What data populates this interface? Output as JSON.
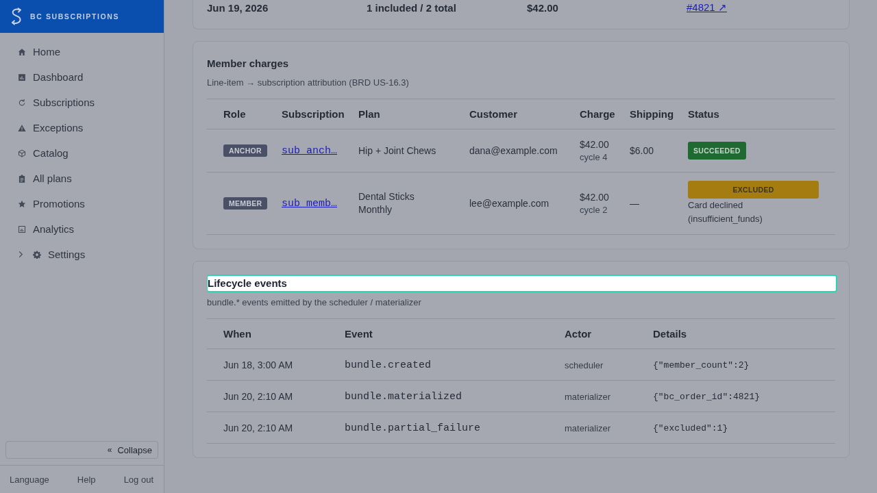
{
  "sidebar": {
    "brand": "BC SUBSCRIPTIONS",
    "items": [
      {
        "label": "Home",
        "kind": "link",
        "selected": false
      },
      {
        "label": "Dashboard",
        "kind": "link",
        "selected": false
      },
      {
        "label": "Subscriptions",
        "kind": "link",
        "selected": false
      },
      {
        "label": "Exceptions",
        "kind": "link",
        "selected": false
      },
      {
        "label": "Catalog",
        "kind": "link",
        "selected": false
      },
      {
        "label": "All plans",
        "kind": "link",
        "selected": false
      },
      {
        "label": "Promotions",
        "kind": "link",
        "selected": false
      },
      {
        "label": "Analytics",
        "kind": "link",
        "selected": false
      },
      {
        "label": "Settings",
        "kind": "group",
        "selected": false,
        "expanded": false
      }
    ],
    "collapse": {
      "glyph": "«",
      "label": "Collapse"
    },
    "footer_links": [
      "Language",
      "Help",
      "Log out"
    ]
  },
  "summary_card": {
    "row": [
      {
        "kind": "text",
        "text": "Jun 19, 2026"
      },
      {
        "kind": "text",
        "text": "1 included / 2 total"
      },
      {
        "kind": "text",
        "text": "$42.00"
      },
      {
        "kind": "link",
        "text": "#4821 ↗"
      }
    ]
  },
  "member_charges": {
    "title": "Member charges",
    "highlighted": false,
    "subtitle": "Line-item → subscription attribution (BRD US-16.3)",
    "columns": [
      "Role",
      "Subscription",
      "Plan",
      "Customer",
      "Charge",
      "Shipping",
      "Status"
    ],
    "rows": [
      {
        "role": "ANCHOR",
        "subscription": "sub_anch…",
        "plan": "Hip + Joint Chews",
        "customer": "dana@example.com",
        "charge": "$42.00",
        "cycle": "cycle 4",
        "shipping": "$6.00",
        "status": {
          "kind": "succeeded",
          "label": "SUCCEEDED"
        }
      },
      {
        "role": "MEMBER",
        "subscription": "sub_memb…",
        "plan": "Dental Sticks Monthly",
        "customer": "lee@example.com",
        "charge": "$42.00",
        "cycle": "cycle 2",
        "shipping": "—",
        "status": {
          "kind": "excluded",
          "label": "EXCLUDED",
          "note": "Card declined (insufficient_funds)"
        }
      }
    ]
  },
  "lifecycle": {
    "title": "Lifecycle events",
    "highlighted": true,
    "subtitle": "bundle.* events emitted by the scheduler / materializer",
    "columns": [
      "When",
      "Event",
      "Actor",
      "Details"
    ],
    "rows": [
      {
        "when": "Jun 18, 3:00 AM",
        "event": "bundle.created",
        "actor": "scheduler",
        "details": "{\"member_count\":2}"
      },
      {
        "when": "Jun 20, 2:10 AM",
        "event": "bundle.materialized",
        "actor": "materializer",
        "details": "{\"bc_order_id\":4821}"
      },
      {
        "when": "Jun 20, 2:10 AM",
        "event": "bundle.partial_failure",
        "actor": "materializer",
        "details": "{\"excluded\":1}"
      }
    ]
  }
}
